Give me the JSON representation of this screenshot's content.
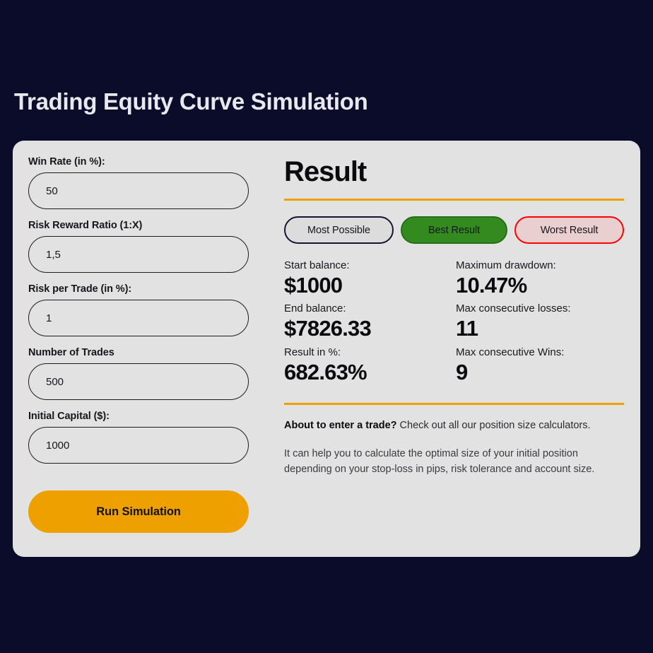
{
  "page": {
    "title": "Trading Equity Curve Simulation",
    "background_color": "#0a0c29",
    "card_color": "#e2e2e2",
    "accent_color": "#eda000"
  },
  "form": {
    "fields": [
      {
        "label": "Win Rate (in %):",
        "value": "50",
        "placeholder": ""
      },
      {
        "label": "Risk Reward Ratio (1:X)",
        "value": "1,5",
        "placeholder": ""
      },
      {
        "label": "Risk per Trade (in %):",
        "value": "1",
        "placeholder": ""
      },
      {
        "label": "Number of Trades",
        "value": "500",
        "placeholder": ""
      },
      {
        "label": "Initial Capital ($):",
        "value": "1000",
        "placeholder": ""
      }
    ],
    "submit_label": "Run Simulation"
  },
  "result": {
    "heading": "Result",
    "tabs": [
      {
        "label": "Most Possible",
        "state": "inactive",
        "color": "#141633"
      },
      {
        "label": "Best Result",
        "state": "active",
        "color": "#338a1e"
      },
      {
        "label": "Worst Result",
        "state": "inactive",
        "color": "#ff0000"
      }
    ],
    "stats": [
      {
        "label": "Start balance:",
        "value": "$1000"
      },
      {
        "label": "Maximum drawdown:",
        "value": "10.47%"
      },
      {
        "label": "End balance:",
        "value": "$7826.33"
      },
      {
        "label": "Max consecutive losses:",
        "value": "11"
      },
      {
        "label": "Result in %:",
        "value": "682.63%"
      },
      {
        "label": "Max consecutive Wins:",
        "value": "9"
      }
    ],
    "info": {
      "lead_bold": "About to enter a trade?",
      "lead_rest": " Check out all our position size calculators.",
      "body": "It can help you to calculate the optimal size of your initial position depending on your stop-loss in pips, risk tolerance and account size."
    }
  }
}
